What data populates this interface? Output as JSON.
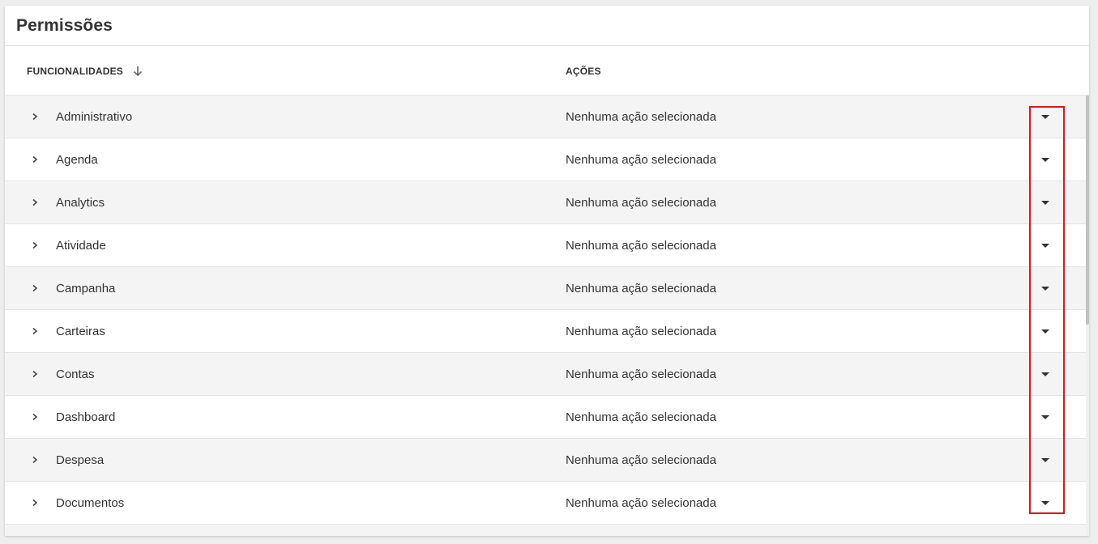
{
  "card": {
    "title": "Permissões"
  },
  "table": {
    "headers": {
      "funcionalidades": "FUNCIONALIDADES",
      "acoes": "AÇÕES"
    },
    "rows": [
      {
        "name": "Administrativo",
        "action": "Nenhuma ação selecionada"
      },
      {
        "name": "Agenda",
        "action": "Nenhuma ação selecionada"
      },
      {
        "name": "Analytics",
        "action": "Nenhuma ação selecionada"
      },
      {
        "name": "Atividade",
        "action": "Nenhuma ação selecionada"
      },
      {
        "name": "Campanha",
        "action": "Nenhuma ação selecionada"
      },
      {
        "name": "Carteiras",
        "action": "Nenhuma ação selecionada"
      },
      {
        "name": "Contas",
        "action": "Nenhuma ação selecionada"
      },
      {
        "name": "Dashboard",
        "action": "Nenhuma ação selecionada"
      },
      {
        "name": "Despesa",
        "action": "Nenhuma ação selecionada"
      },
      {
        "name": "Documentos",
        "action": "Nenhuma ação selecionada"
      }
    ]
  },
  "icons": {
    "sort": "arrow-down-icon",
    "expand": "chevron-right-icon",
    "dropdown": "caret-down-icon"
  },
  "colors": {
    "highlight": "#e0161a",
    "row_shaded": "#f4f4f4",
    "row_white": "#ffffff"
  }
}
